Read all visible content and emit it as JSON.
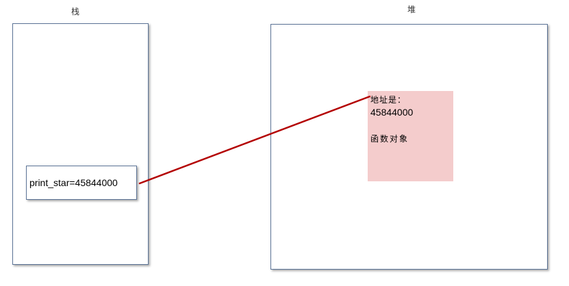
{
  "stack": {
    "title": "栈",
    "variable": "print_star=45844000"
  },
  "heap": {
    "title": "堆",
    "object": {
      "address_label": "地址是：",
      "address_value": "45844000",
      "kind": "函数对象"
    }
  },
  "colors": {
    "box_border": "#5b7396",
    "object_fill": "#f4cccc",
    "arrow": "#b30000"
  }
}
